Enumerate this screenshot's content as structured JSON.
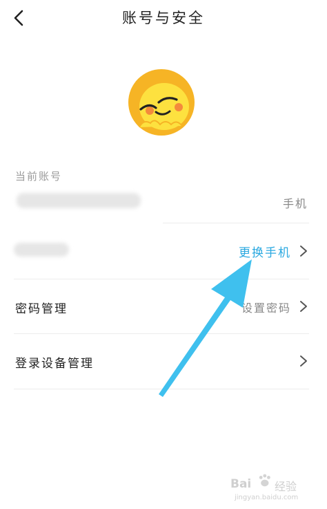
{
  "header": {
    "title": "账号与安全"
  },
  "account": {
    "section_label": "当前账号",
    "phone_type": "手机"
  },
  "phone_row": {
    "action_label": "更换手机"
  },
  "password_row": {
    "label": "密码管理",
    "value": "设置密码"
  },
  "device_row": {
    "label": "登录设备管理"
  },
  "watermark": {
    "brand": "Bai",
    "brand_cn": "经验",
    "url": "jingyan.baidu.com"
  },
  "colors": {
    "accent": "#29a8e0",
    "arrow": "#3fc0ee",
    "avatar": "#f6b425"
  },
  "icons": {
    "back": "chevron-left-icon",
    "chevron": "chevron-right-icon",
    "avatar": "smiley-avatar-icon"
  }
}
